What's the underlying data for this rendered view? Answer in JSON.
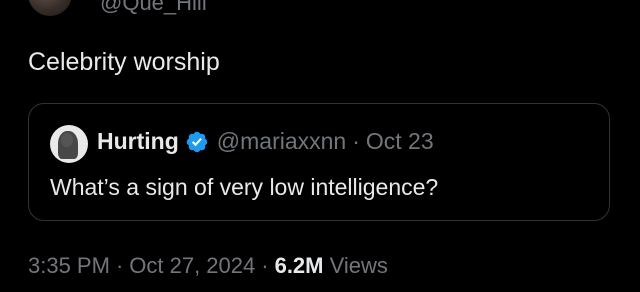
{
  "author": {
    "handle": "@Que_Hill"
  },
  "tweet": {
    "text": "Celebrity worship"
  },
  "quote": {
    "name": "Hurting",
    "handle": "@mariaxxnn",
    "separator": "·",
    "date": "Oct 23",
    "text": "What’s a sign of very low intelligence?",
    "verified_icon": "verified-badge-icon",
    "verified_color": "#1d9bf0"
  },
  "meta": {
    "time": "3:35 PM",
    "separator": "·",
    "date": "Oct 27, 2024",
    "views_count": "6.2M",
    "views_label": "Views"
  }
}
